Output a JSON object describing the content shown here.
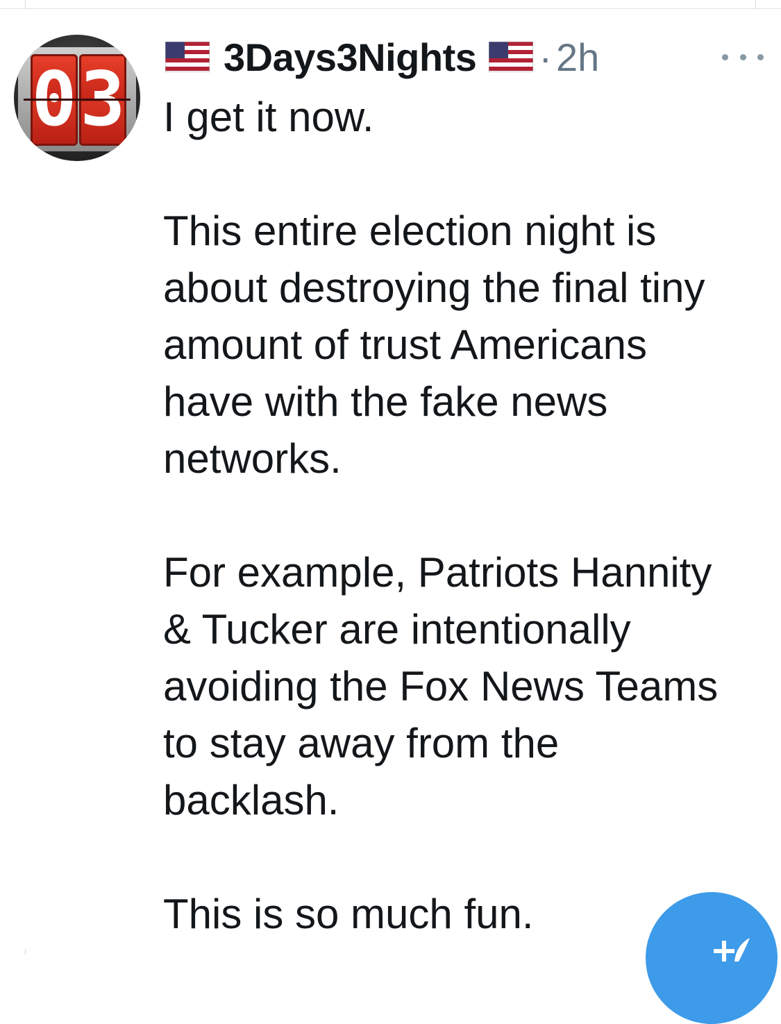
{
  "post": {
    "display_name": "3Days3Nights",
    "separator": "·",
    "timestamp": "2h",
    "avatar_text": {
      "digit_1": "0",
      "digit_2": "3"
    },
    "paragraphs": [
      "I get it now.",
      "This entire election night is\nabout destroying the final tiny\namount of trust Americans\nhave with the fake news\nnetworks.",
      "For example, Patriots Hannity\n& Tucker are intentionally\navoiding the Fox News Teams\nto stay away from the\nbacklash.",
      "This is so much fun."
    ]
  },
  "icons": {
    "name_prefix_flag": "us-flag-icon",
    "name_suffix_flag": "us-flag-icon",
    "more_menu": "more-horizontal-icon",
    "compose": "compose-icon"
  },
  "colors": {
    "text_primary": "#14171a",
    "text_secondary": "#657786",
    "fab_blue": "#3d9be9",
    "avatar_red": "#c8271a"
  }
}
